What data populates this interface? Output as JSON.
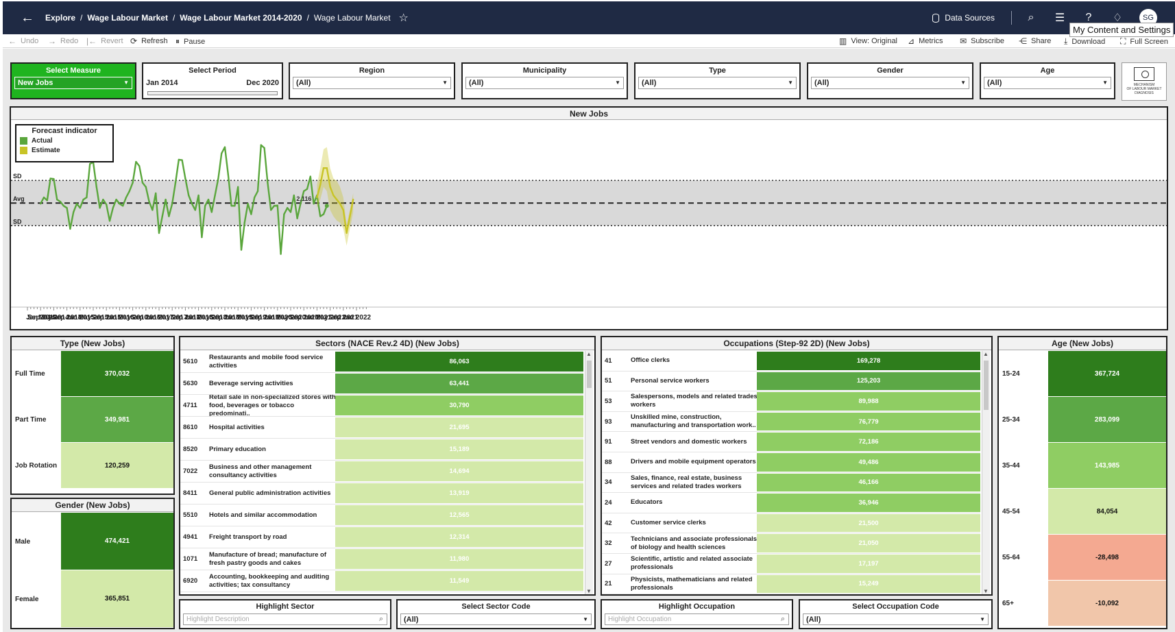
{
  "breadcrumb": [
    "Explore",
    "Wage Labour Market",
    "Wage Labour Market 2014-2020",
    "Wage Labour Market"
  ],
  "topbar": {
    "data_sources": "Data Sources",
    "avatar": "SG",
    "tooltip": "My Content and Settings"
  },
  "toolbar": {
    "undo": "Undo",
    "redo": "Redo",
    "revert": "Revert",
    "refresh": "Refresh",
    "pause": "Pause",
    "view": "View: Original",
    "metrics": "Metrics",
    "subscribe": "Subscribe",
    "share": "Share",
    "download": "Download",
    "fullscreen": "Full Screen"
  },
  "filters": {
    "measure": {
      "title": "Select Measure",
      "value": "New Jobs"
    },
    "period": {
      "title": "Select Period",
      "start": "Jan 2014",
      "end": "Dec 2020"
    },
    "region": {
      "title": "Region",
      "value": "(All)"
    },
    "municipality": {
      "title": "Municipality",
      "value": "(All)"
    },
    "type": {
      "title": "Type",
      "value": "(All)"
    },
    "gender": {
      "title": "Gender",
      "value": "(All)"
    },
    "age": {
      "title": "Age",
      "value": "(All)"
    }
  },
  "logo_text": [
    "MECHANISM",
    "OF LABOUR MARKET",
    "DIAGNOSIS"
  ],
  "colors": {
    "actual": "#5aa63c",
    "estimate": "#c8c426",
    "band": "#d9d9d9",
    "dark_green": "#2e7d1c",
    "mid_green": "#5ca846",
    "light_green": "#8fcd63",
    "pale_green": "#d3e9a9",
    "salmon": "#f4a991",
    "peach": "#f1c6aa"
  },
  "chart_data": {
    "type": "line",
    "title": "New Jobs",
    "legend": {
      "title": "Forecast indicator",
      "items": [
        "Actual",
        "Estimate"
      ],
      "placement": "top-left"
    },
    "reference_labels": {
      "upper": "SD",
      "avg": "Avg",
      "lower": "SD"
    },
    "last_value_label": "2,116",
    "x_tick_labels": [
      "Sep 2013",
      "Jan 2014",
      "May 2014",
      "Sep 2014",
      "Jan 2015",
      "May 2015",
      "Sep 2015",
      "Jan 2016",
      "May 2016",
      "Sep 2016",
      "Jan 2017",
      "May 2017",
      "Sep 2017",
      "Jan 2018",
      "May 2018",
      "Sep 2018",
      "Jan 2019",
      "May 2019",
      "Sep 2019",
      "Jan 2020",
      "May 2020",
      "Sep 2020",
      "Jan 2021",
      "May 2021",
      "Sep 2021",
      "Jan 2022"
    ],
    "y_avg": 2116,
    "y_sd": 540,
    "ylim": [
      -300,
      4000
    ],
    "x_start": "Jan 2014",
    "series": [
      {
        "name": "Actual",
        "values": [
          2100,
          2250,
          2180,
          2700,
          2690,
          2200,
          2150,
          2050,
          2000,
          1500,
          1900,
          2100,
          2000,
          2200,
          2250,
          3050,
          3090,
          2500,
          2000,
          2200,
          2080,
          1690,
          2000,
          2200,
          2100,
          2050,
          2250,
          2400,
          2600,
          3100,
          3000,
          2600,
          2500,
          2150,
          1950,
          2350,
          1400,
          1800,
          2200,
          1800,
          2100,
          2600,
          3150,
          3140,
          2700,
          2300,
          2100,
          1950,
          2300,
          1300,
          2050,
          2200,
          1900,
          2300,
          2700,
          3300,
          3450,
          2800,
          2050,
          2050,
          2500,
          1000,
          1650,
          2100,
          1850,
          2250,
          2400,
          3500,
          3430,
          2600,
          1950,
          2050,
          2060,
          900,
          1850,
          2000,
          1900,
          2300,
          1750,
          2100,
          2400,
          2450,
          2750,
          2100,
          2300,
          1800,
          1850,
          2050
        ]
      },
      {
        "name": "Estimate",
        "values": [
          2250,
          2550,
          2950,
          2950,
          2500,
          2300,
          2200,
          2100,
          1950,
          1400,
          1800,
          2200
        ],
        "lower": [
          2000,
          2200,
          2500,
          2400,
          1950,
          1800,
          1700,
          1650,
          1500,
          1100,
          1500,
          1900
        ],
        "upper": [
          2550,
          2950,
          3400,
          3450,
          2950,
          2700,
          2650,
          2500,
          2250,
          1600,
          1950,
          2350
        ]
      }
    ]
  },
  "type_panel": {
    "title": "Type (New Jobs)",
    "rows": [
      {
        "label": "Full Time",
        "value": "370,032"
      },
      {
        "label": "Part Time",
        "value": "349,981"
      },
      {
        "label": "Job Rotation",
        "value": "120,259"
      }
    ]
  },
  "gender_panel": {
    "title": "Gender (New Jobs)",
    "rows": [
      {
        "label": "Male",
        "value": "474,421"
      },
      {
        "label": "Female",
        "value": "365,851"
      }
    ]
  },
  "sectors": {
    "title": "Sectors (NACE Rev.2 4D) (New Jobs)",
    "rows": [
      {
        "code": "5610",
        "desc": "Restaurants and mobile food service activities",
        "value": "86,063"
      },
      {
        "code": "5630",
        "desc": "Beverage serving activities",
        "value": "63,441"
      },
      {
        "code": "4711",
        "desc": "Retail sale in non-specialized stores with food, beverages or tobacco predominati..",
        "value": "30,790"
      },
      {
        "code": "8610",
        "desc": "Hospital activities",
        "value": "21,695"
      },
      {
        "code": "8520",
        "desc": "Primary education",
        "value": "15,189"
      },
      {
        "code": "7022",
        "desc": "Business and other management consultancy activities",
        "value": "14,694"
      },
      {
        "code": "8411",
        "desc": "General public administration activities",
        "value": "13,919"
      },
      {
        "code": "5510",
        "desc": "Hotels and similar accommodation",
        "value": "12,565"
      },
      {
        "code": "4941",
        "desc": "Freight transport by road",
        "value": "12,314"
      },
      {
        "code": "1071",
        "desc": "Manufacture of bread; manufacture of fresh pastry goods and cakes",
        "value": "11,980"
      },
      {
        "code": "6920",
        "desc": "Accounting, bookkeeping and auditing activities; tax consultancy",
        "value": "11,549"
      }
    ]
  },
  "occupations": {
    "title": "Occupations (Step-92 2D) (New Jobs)",
    "rows": [
      {
        "code": "41",
        "desc": "Office clerks",
        "value": "169,278"
      },
      {
        "code": "51",
        "desc": "Personal service workers",
        "value": "125,203"
      },
      {
        "code": "53",
        "desc": "Salespersons, models and related trades workers",
        "value": "89,988"
      },
      {
        "code": "93",
        "desc": "Unskilled mine, construction, manufacturing and transportation work..",
        "value": "76,779"
      },
      {
        "code": "91",
        "desc": "Street vendors and domestic workers",
        "value": "72,186"
      },
      {
        "code": "88",
        "desc": "Drivers  and mobile equipment operators",
        "value": "49,486"
      },
      {
        "code": "34",
        "desc": "Sales, finance, real estate, business services and related trades workers",
        "value": "46,166"
      },
      {
        "code": "24",
        "desc": "Educators",
        "value": "36,946"
      },
      {
        "code": "42",
        "desc": "Customer service clerks",
        "value": "21,500"
      },
      {
        "code": "32",
        "desc": "Technicians and associate professionals of biology and health sciences",
        "value": "21,050"
      },
      {
        "code": "27",
        "desc": "Scientific, artistic and related associate professionals",
        "value": "17,197"
      },
      {
        "code": "21",
        "desc": "Physicists, mathematicians and related professionals",
        "value": "15,249"
      }
    ]
  },
  "age_panel": {
    "title": "Age (New Jobs)",
    "rows": [
      {
        "label": "15-24",
        "value": "367,724"
      },
      {
        "label": "25-34",
        "value": "283,099"
      },
      {
        "label": "35-44",
        "value": "143,985"
      },
      {
        "label": "45-54",
        "value": "84,054"
      },
      {
        "label": "55-64",
        "value": "-28,498"
      },
      {
        "label": "65+",
        "value": "-10,092"
      }
    ]
  },
  "bottom_filters": {
    "highlight_sector": {
      "title": "Highlight Sector",
      "placeholder": "Highlight Description"
    },
    "select_sector_code": {
      "title": "Select Sector Code",
      "value": "(All)"
    },
    "highlight_occupation": {
      "title": "Highlight Occupation",
      "placeholder": "Highlight Occupation"
    },
    "select_occupation_code": {
      "title": "Select Occupation Code",
      "value": "(All)"
    }
  }
}
